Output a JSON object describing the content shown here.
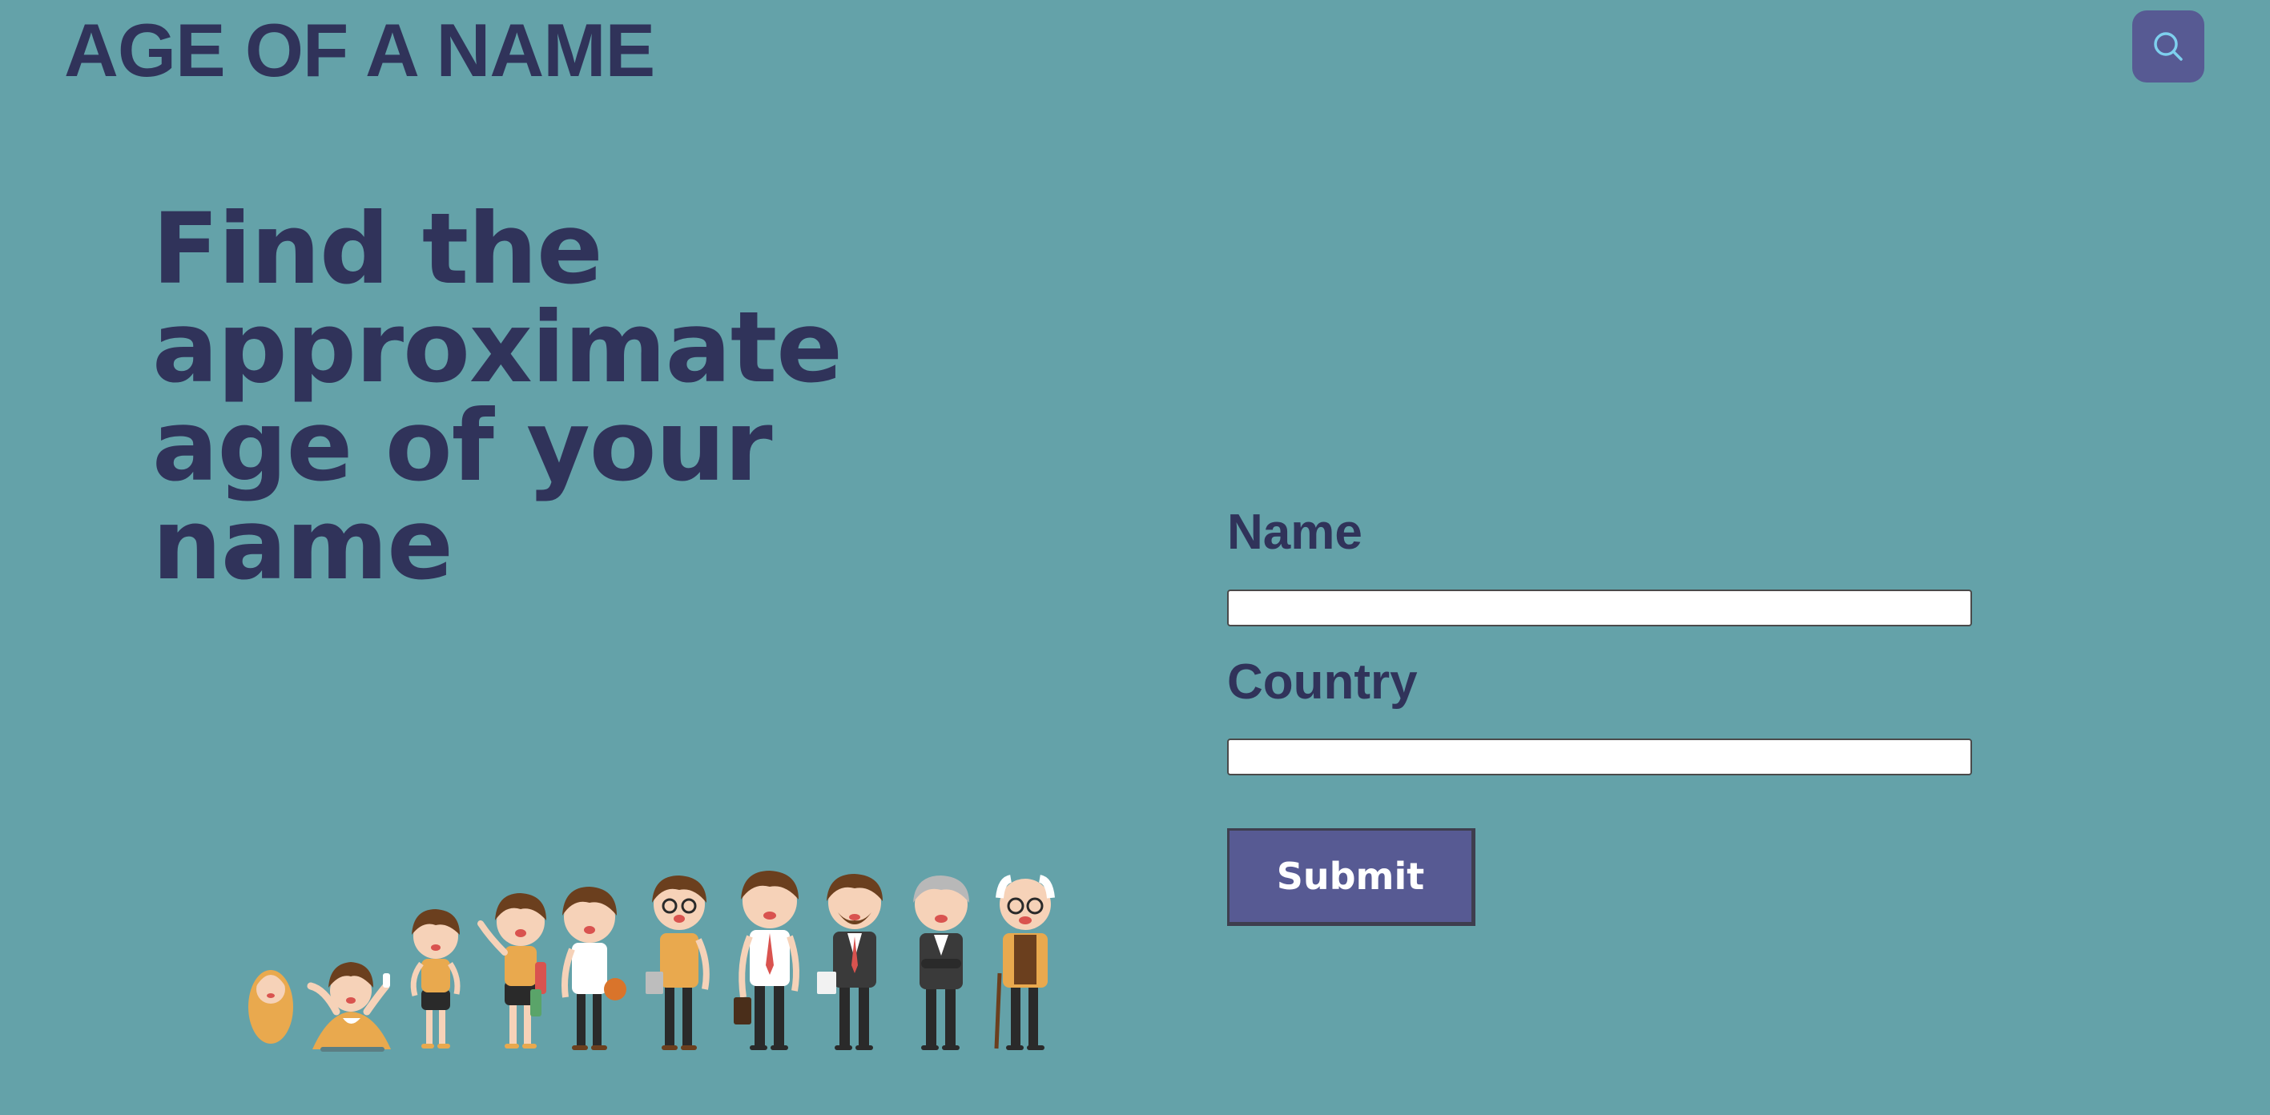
{
  "header": {
    "logo_text": "AGE OF A NAME",
    "search_icon": "search-icon"
  },
  "hero": {
    "headline": "Find the approximate age of your name",
    "illustration": "people-growing-older-illustration"
  },
  "form": {
    "name_label": "Name",
    "name_value": "",
    "country_label": "Country",
    "country_value": "",
    "submit_label": "Submit"
  },
  "colors": {
    "background": "#64a2a9",
    "text_dark": "#30335a",
    "accent": "#575a93",
    "search_icon_stroke": "#7ed0ee"
  }
}
